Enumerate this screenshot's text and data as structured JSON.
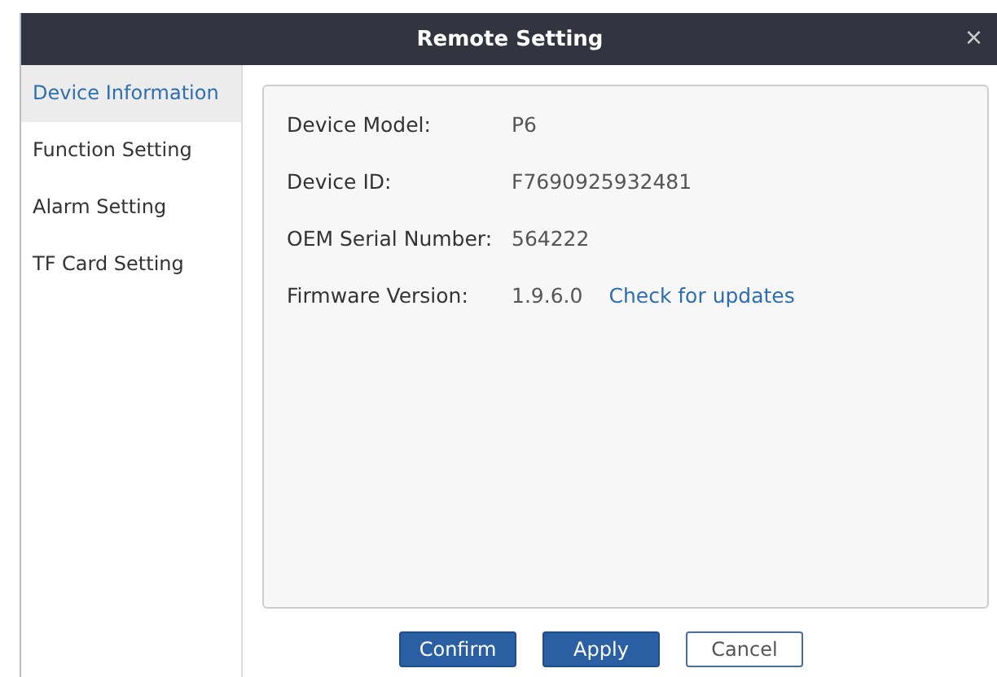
{
  "window": {
    "title": "Remote Setting",
    "close": "×"
  },
  "sidebar": {
    "items": [
      {
        "label": "Device Information",
        "selected": true
      },
      {
        "label": "Function Setting",
        "selected": false
      },
      {
        "label": "Alarm Setting",
        "selected": false
      },
      {
        "label": "TF Card Setting",
        "selected": false
      }
    ]
  },
  "fields": [
    {
      "label": "Device Model:",
      "value": "P6"
    },
    {
      "label": "Device ID:",
      "value": "F7690925932481"
    },
    {
      "label": "OEM Serial Number:",
      "value": "564222"
    },
    {
      "label": "Firmware Version:",
      "value": "1.9.6.0",
      "link": "Check for updates"
    }
  ],
  "buttons": [
    {
      "label": "Confirm",
      "kind": "primary"
    },
    {
      "label": "Apply",
      "kind": "primary"
    },
    {
      "label": "Cancel",
      "kind": "secondary"
    }
  ]
}
